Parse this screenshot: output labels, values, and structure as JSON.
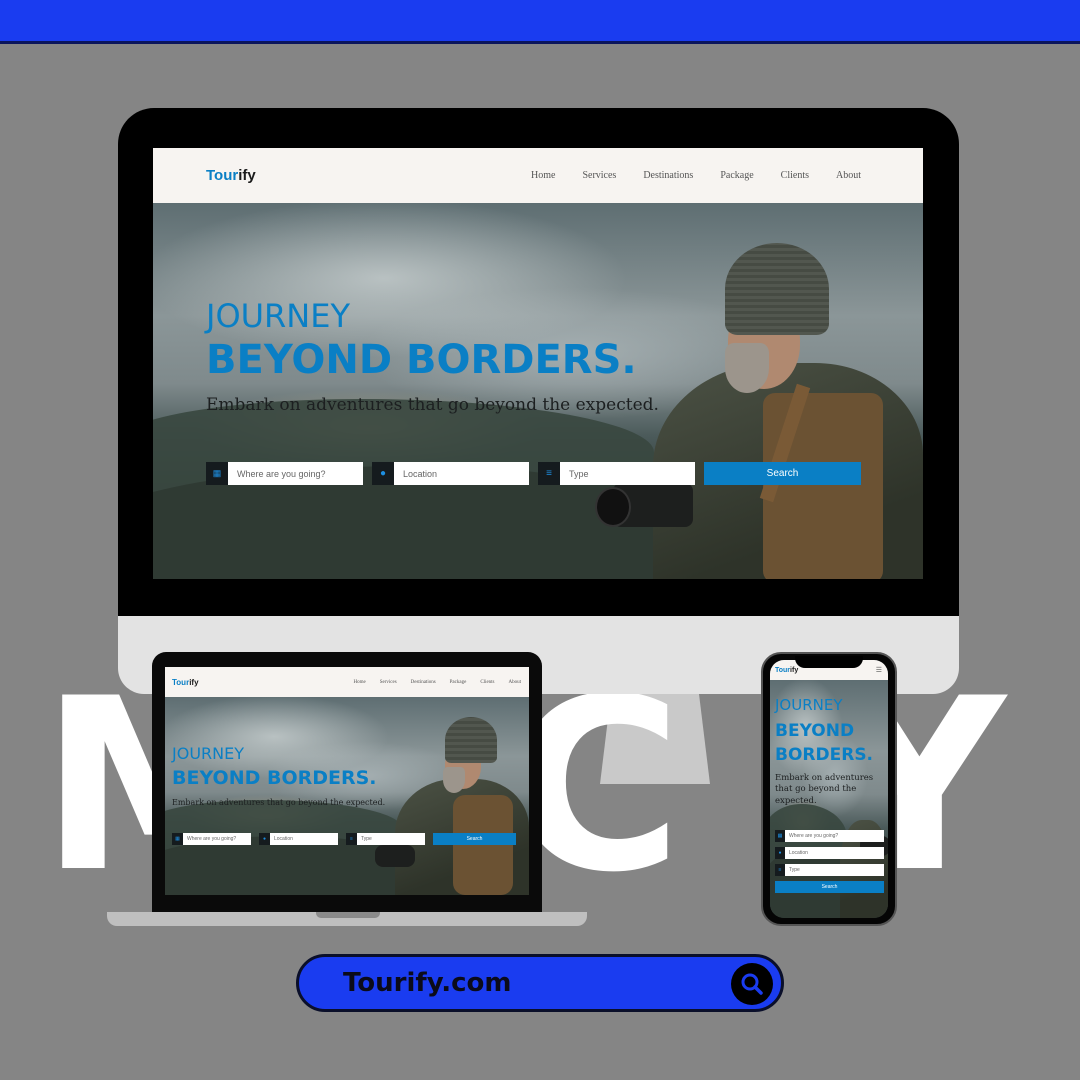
{
  "background_word": "MEC Y",
  "site": {
    "brand_prefix": "Tour",
    "brand_suffix": "ify",
    "nav": [
      "Home",
      "Services",
      "Destinations",
      "Package",
      "Clients",
      "About"
    ],
    "hero": {
      "line1": "JOURNEY",
      "line2": "BEYOND BORDERS.",
      "subtitle": "Embark on adventures that go beyond the expected."
    },
    "search": {
      "destination_placeholder": "Where are you going?",
      "location_placeholder": "Location",
      "type_placeholder": "Type",
      "button_label": "Search"
    }
  },
  "url_bar": {
    "text": "Tourify.com",
    "icon": "search-icon"
  },
  "colors": {
    "top_bar": "#1a3cf0",
    "brand_accent": "#0a7fc5",
    "background": "#858585"
  }
}
